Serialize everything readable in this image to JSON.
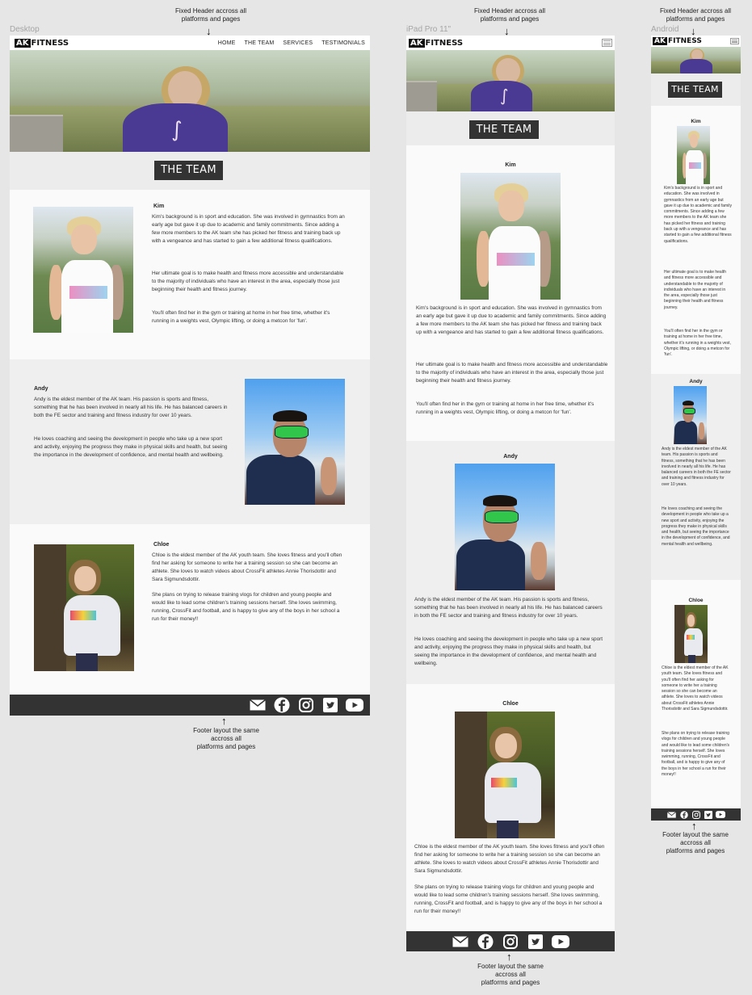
{
  "devices": {
    "desktop": "Desktop",
    "ipad": "iPad Pro 11\"",
    "android": "Android"
  },
  "annotations": {
    "header": "Fixed Header accross all\nplatforms and pages",
    "footer": "Footer layout the same\naccross all\nplatforms and pages"
  },
  "logo": {
    "ak": "AK",
    "text": "FITNESS"
  },
  "nav": [
    "HOME",
    "THE TEAM",
    "SERVICES",
    "TESTIMONIALS"
  ],
  "page_title": "THE TEAM",
  "members": [
    {
      "name": "Kim",
      "paragraphs": [
        "Kim's background is in sport and education. She was involved in gymnastics from an early age but gave it up due to academic and family commitments. Since adding a few more members to the AK team she has picked her fitness and training back up with a vengeance and has started to gain a few additional fitness qualifications.",
        "Her ultimate goal is to make health and fitness more accessible and understandable to the majority of individuals who have an interest in the area, especially those just beginning their health and fitness journey.",
        "You'll often find her in the gym or training at home in her free time, whether it's running in a weights vest, Olympic lifting, or doing a metcon for 'fun'."
      ]
    },
    {
      "name": "Andy",
      "paragraphs": [
        "Andy is the eldest member of the AK team. His passion is sports and fitness, something that he has been involved in nearly all his life. He has balanced careers in both the FE sector and training and fitness industry for over 10 years.",
        "He loves coaching and seeing the development in people who take up a new sport and activity, enjoying the progress they make in physical skills and health, but seeing the importance in the development of confidence, and mental health and wellbeing."
      ]
    },
    {
      "name": "Chloe",
      "paragraphs": [
        "Chloe is the eldest member of the AK youth team. She loves fitness and you'll often find her asking for someone to write her a training session so she can become an athlete. She loves to watch videos about CrossFit athletes Annie Thorisdottir and Sara Sigmundsdottir.",
        "She plans on trying to release training vlogs for children and young people and would like to lead some children's training sessions herself. She loves swimming, running, CrossFit and football, and is happy to give any of the boys in her school a run for their money!!"
      ]
    }
  ],
  "footer_icons": [
    "envelope-icon",
    "facebook-icon",
    "instagram-icon",
    "twitter-icon",
    "youtube-icon"
  ],
  "colors": {
    "dark": "#333333",
    "page_bg": "#e6e6e6"
  }
}
